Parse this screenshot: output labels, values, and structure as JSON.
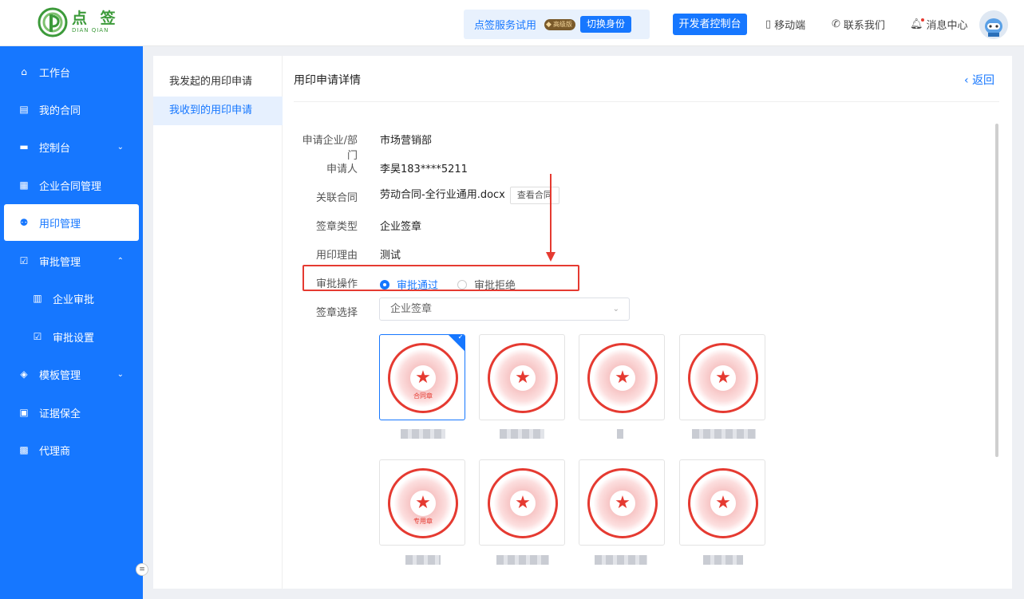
{
  "brand": {
    "cn": "点 签",
    "en": "DIAN QIAN"
  },
  "header": {
    "trial_text": "点签服务试用",
    "vip_badge": "高级版",
    "switch_label": "切换身份",
    "dev_console": "开发者控制台",
    "mobile": "移动端",
    "contact": "联系我们",
    "messages": "消息中心"
  },
  "sidebar": {
    "items": [
      {
        "label": "工作台"
      },
      {
        "label": "我的合同"
      },
      {
        "label": "控制台"
      },
      {
        "label": "企业合同管理"
      },
      {
        "label": "用印管理"
      },
      {
        "label": "审批管理"
      },
      {
        "label": "企业审批"
      },
      {
        "label": "审批设置"
      },
      {
        "label": "模板管理"
      },
      {
        "label": "证据保全"
      },
      {
        "label": "代理商"
      }
    ]
  },
  "subnav": {
    "items": [
      {
        "label": "我发起的用印申请"
      },
      {
        "label": "我收到的用印申请"
      }
    ]
  },
  "detail": {
    "title": "用印申请详情",
    "back": "返回",
    "fields": {
      "dept_label": "申请企业/部门",
      "dept_value": "市场营销部",
      "applicant_label": "申请人",
      "applicant_value": "李昊183****5211",
      "contract_label": "关联合同",
      "contract_value": "劳动合同-全行业通用.docx",
      "view_contract": "查看合同",
      "seal_type_label": "签章类型",
      "seal_type_value": "企业签章",
      "reason_label": "用印理由",
      "reason_value": "测试",
      "approval_label": "审批操作",
      "approve": "审批通过",
      "reject": "审批拒绝",
      "seal_select_label": "签章选择",
      "seal_select_value": "企业签章"
    },
    "seals": [
      {
        "label": "合同章"
      },
      {
        "label": ""
      },
      {
        "label": ""
      },
      {
        "label": ""
      },
      {
        "label": "专用章"
      },
      {
        "label": ""
      },
      {
        "label": ""
      },
      {
        "label": ""
      }
    ]
  }
}
